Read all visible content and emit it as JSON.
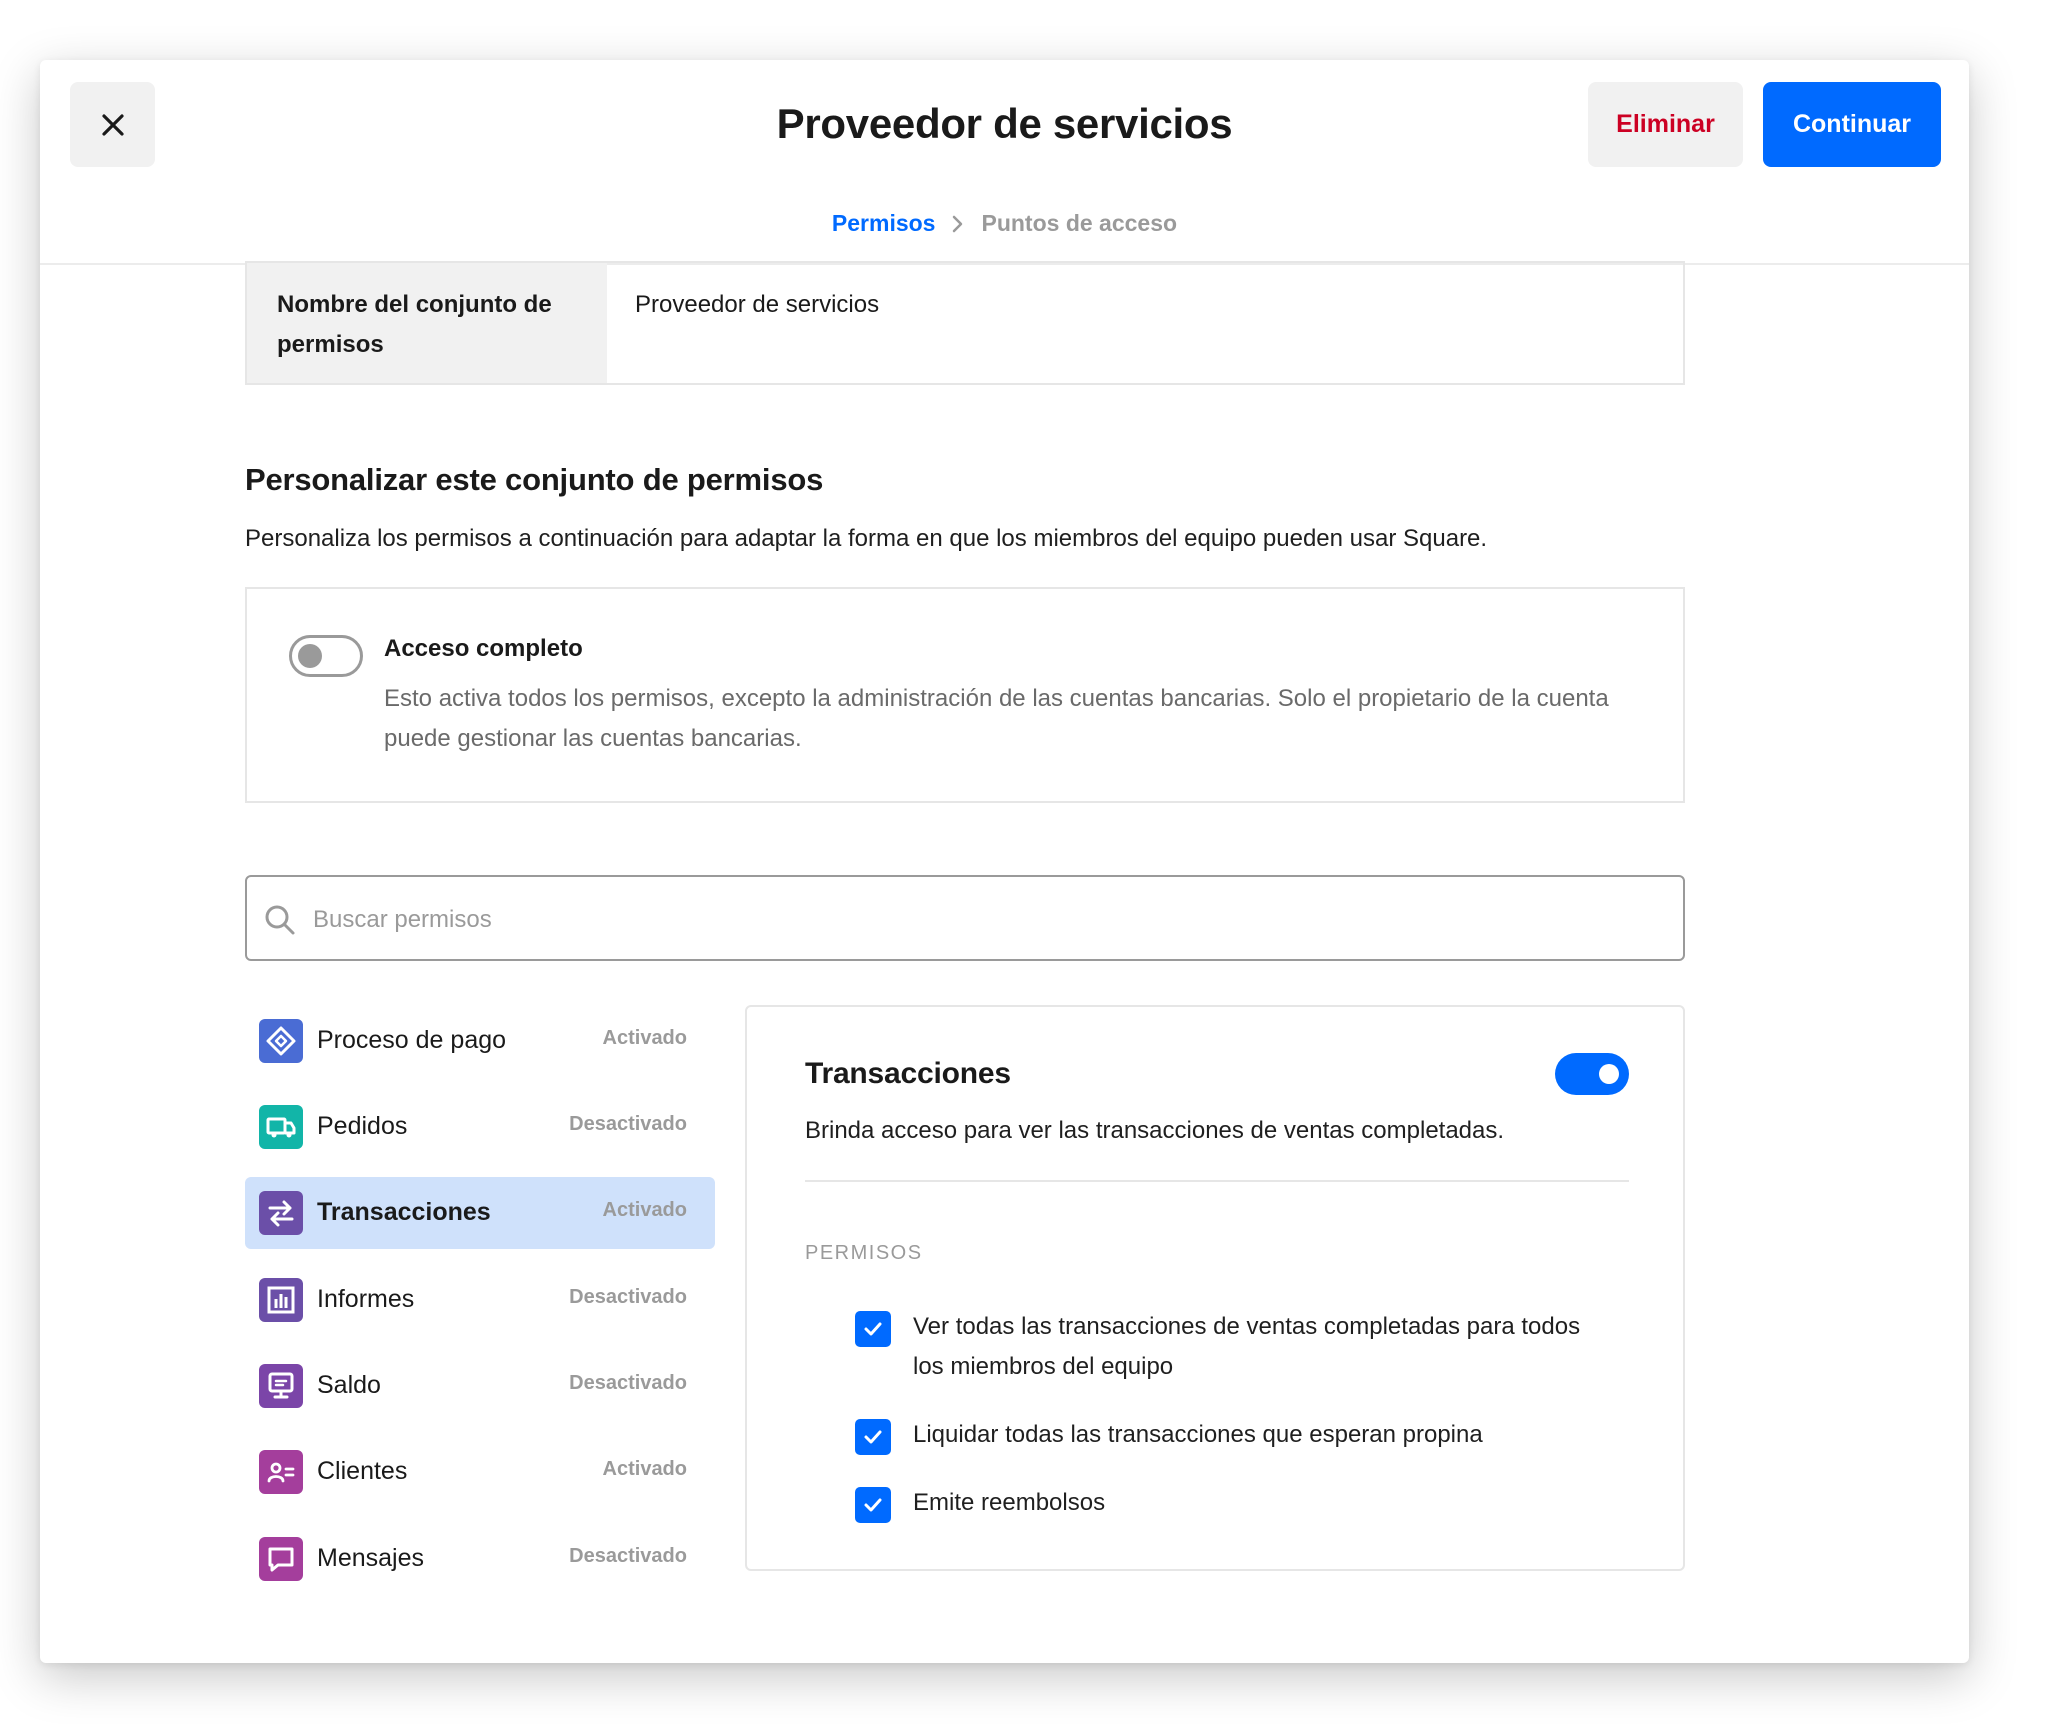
{
  "header": {
    "title": "Proveedor de servicios",
    "delete_label": "Eliminar",
    "continue_label": "Continuar"
  },
  "breadcrumb": {
    "step1": "Permisos",
    "step2": "Puntos de acceso"
  },
  "name_field": {
    "label": "Nombre del conjunto de permisos",
    "value": "Proveedor de servicios"
  },
  "customize": {
    "title": "Personalizar este conjunto de permisos",
    "description": "Personaliza los permisos a continuación para adaptar la forma en que los miembros del equipo pueden usar Square."
  },
  "full_access": {
    "title": "Acceso completo",
    "description": "Esto activa todos los permisos, excepto la administración de las cuentas bancarias. Solo el propietario de la cuenta puede gestionar las cuentas bancarias.",
    "enabled": false
  },
  "search": {
    "placeholder": "Buscar permisos"
  },
  "categories": [
    {
      "label": "Proceso de pago",
      "status": "Activado",
      "icon": "checkout-icon",
      "color": "#4a6cd4"
    },
    {
      "label": "Pedidos",
      "status": "Desactivado",
      "icon": "truck-icon",
      "color": "#12b5a8"
    },
    {
      "label": "Transacciones",
      "status": "Activado",
      "icon": "transfer-icon",
      "color": "#6b4fa8"
    },
    {
      "label": "Informes",
      "status": "Desactivado",
      "icon": "bar-chart-icon",
      "color": "#6b4fa8"
    },
    {
      "label": "Saldo",
      "status": "Desactivado",
      "icon": "terminal-icon",
      "color": "#7b45a8"
    },
    {
      "label": "Clientes",
      "status": "Activado",
      "icon": "contact-card-icon",
      "color": "#a43e9c"
    },
    {
      "label": "Mensajes",
      "status": "Desactivado",
      "icon": "message-icon",
      "color": "#a43e9c"
    }
  ],
  "selected_category": "Transacciones",
  "detail": {
    "title": "Transacciones",
    "description": "Brinda acceso para ver las transacciones de ventas completadas.",
    "enabled": true,
    "permissions_heading": "PERMISOS",
    "permissions": [
      {
        "label": "Ver todas las transacciones de ventas completadas para todos los miembros del equipo",
        "checked": true
      },
      {
        "label": "Liquidar todas las transacciones que esperan propina",
        "checked": true
      },
      {
        "label": "Emite reembolsos",
        "checked": true
      }
    ]
  },
  "colors": {
    "accent": "#006aff",
    "danger": "#cc0023",
    "selected_bg": "#cfe1fb"
  }
}
